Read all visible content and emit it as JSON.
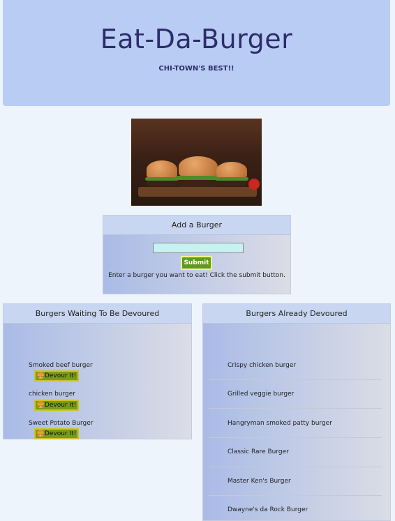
{
  "hero": {
    "title": "Eat-Da-Burger",
    "subtitle": "CHI-TOWN'S BEST!!"
  },
  "hero_image": {
    "alt": "three burgers on a board"
  },
  "add_form": {
    "header": "Add a Burger",
    "input_value": "",
    "submit_label": "Submit",
    "hint": "Enter a burger you want to eat! Click the submit button."
  },
  "waiting": {
    "header": "Burgers Waiting To Be Devoured",
    "button_label": "🍔Devour It!",
    "items": [
      "Smoked beef burger",
      "chicken burger",
      "Sweet Potato Burger"
    ]
  },
  "devoured": {
    "header": "Burgers Already Devoured",
    "items": [
      "Crispy chicken burger",
      "Grilled veggie burger",
      "Hangryman smoked patty burger",
      "Classic Rare Burger",
      "Master Ken's Burger",
      "Dwayne's da Rock Burger"
    ]
  },
  "colors": {
    "hero_bg": "#b9cdf4",
    "title_color": "#2d2d6b",
    "submit_bg": "#5e9a20",
    "devour_bg": "#7a9d16"
  }
}
